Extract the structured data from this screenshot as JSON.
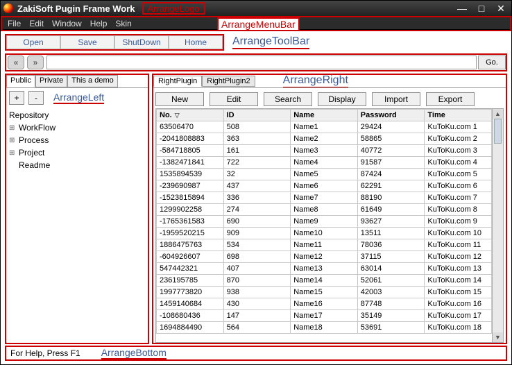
{
  "titlebar": {
    "title": "ZakiSoft Pugin Frame Work",
    "anno": "ArrangeLogo"
  },
  "menubar": {
    "items": [
      "File",
      "Edit",
      "Window",
      "Help",
      "Skin"
    ],
    "anno": "ArrangeMenuBar"
  },
  "toolbar": {
    "buttons": [
      "Open",
      "Save",
      "ShutDown",
      "Home"
    ],
    "anno": "ArrangeToolBar"
  },
  "navbar": {
    "go": "Go."
  },
  "left": {
    "tabs": [
      "Public",
      "Private",
      "This a demo"
    ],
    "anno": "ArrangeLeft",
    "tree_root": "Repository",
    "tree": [
      {
        "label": "WorkFlow",
        "exp": true
      },
      {
        "label": "Process",
        "exp": true
      },
      {
        "label": "Project",
        "exp": true
      },
      {
        "label": "Readme",
        "exp": false
      }
    ]
  },
  "right": {
    "tabs": [
      "RightPlugin",
      "RightPlugin2"
    ],
    "anno": "ArrangeRight",
    "buttons": [
      "New",
      "Edit",
      "Search",
      "Display",
      "Import",
      "Export"
    ],
    "columns": [
      "No.",
      "ID",
      "Name",
      "Password",
      "Time"
    ],
    "rows": [
      [
        "63506470",
        "508",
        "Name1",
        "29424",
        "KuToKu.com 1"
      ],
      [
        "-2041808883",
        "363",
        "Name2",
        "58865",
        "KuToKu.com 2"
      ],
      [
        "-584718805",
        "161",
        "Name3",
        "40772",
        "KuToKu.com 3"
      ],
      [
        "-1382471841",
        "722",
        "Name4",
        "91587",
        "KuToKu.com 4"
      ],
      [
        "1535894539",
        "32",
        "Name5",
        "87424",
        "KuToKu.com 5"
      ],
      [
        "-239690987",
        "437",
        "Name6",
        "62291",
        "KuToKu.com 6"
      ],
      [
        "-1523815894",
        "336",
        "Name7",
        "88190",
        "KuToKu.com 7"
      ],
      [
        "1299902258",
        "274",
        "Name8",
        "61649",
        "KuToKu.com 8"
      ],
      [
        "-1765361583",
        "690",
        "Name9",
        "93627",
        "KuToKu.com 9"
      ],
      [
        "-1959520215",
        "909",
        "Name10",
        "13511",
        "KuToKu.com 10"
      ],
      [
        "1886475763",
        "534",
        "Name11",
        "78036",
        "KuToKu.com 11"
      ],
      [
        "-604926607",
        "698",
        "Name12",
        "37115",
        "KuToKu.com 12"
      ],
      [
        "547442321",
        "407",
        "Name13",
        "63014",
        "KuToKu.com 13"
      ],
      [
        "236195785",
        "870",
        "Name14",
        "52061",
        "KuToKu.com 14"
      ],
      [
        "1997773820",
        "938",
        "Name15",
        "42003",
        "KuToKu.com 15"
      ],
      [
        "1459140684",
        "430",
        "Name16",
        "87748",
        "KuToKu.com 16"
      ],
      [
        "-108680436",
        "147",
        "Name17",
        "35149",
        "KuToKu.com 17"
      ],
      [
        "1694884490",
        "564",
        "Name18",
        "53691",
        "KuToKu.com 18"
      ]
    ]
  },
  "bottom": {
    "help": "For Help, Press F1",
    "anno": "ArrangeBottom"
  }
}
